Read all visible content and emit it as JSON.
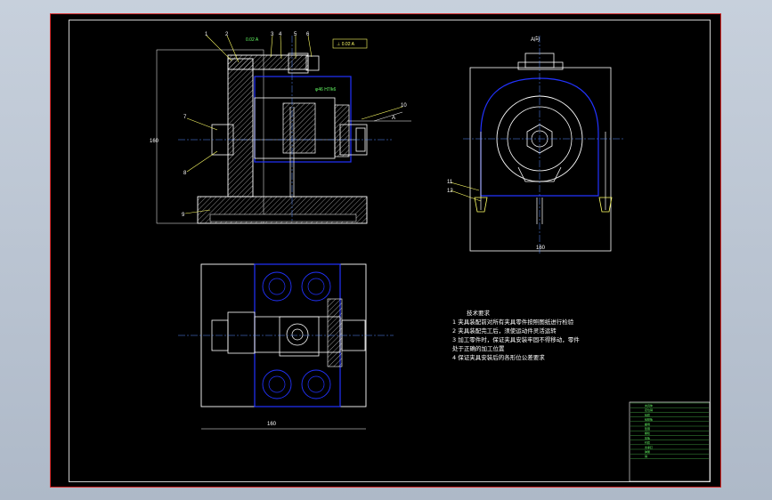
{
  "drawing": {
    "balloons": [
      "1",
      "2",
      "3",
      "4",
      "5",
      "6",
      "7",
      "8",
      "9",
      "10",
      "11",
      "12"
    ],
    "view_a_label": "A向",
    "arrow_label": "A",
    "datum_symbol": "⊥ 0.02 A",
    "dim_h": "160",
    "dim_w1": "160",
    "dim_w2": "160",
    "dim_w3": "220",
    "tol_text": "0.02 A",
    "fit_text": "φ46 H7/k6"
  },
  "notes": {
    "title": "技术要求",
    "lines": [
      "1 夹具装配前对所有夹具零件按照图纸进行检验",
      "2 夹具装配完工后，须使运动件灵活运转",
      "3 加工零件时，保证夹具安装牢固不得移动，零件",
      "   处于正确的加工位置",
      "4 保证夹具安装后的各形位公差要求"
    ]
  },
  "title_block": {
    "rows": [
      "夹具体",
      "定位销",
      "钻套",
      "钻模板",
      "螺母",
      "垫圈",
      "螺栓",
      "压板",
      "衬套",
      "支承钉",
      "弹簧",
      "销"
    ]
  }
}
